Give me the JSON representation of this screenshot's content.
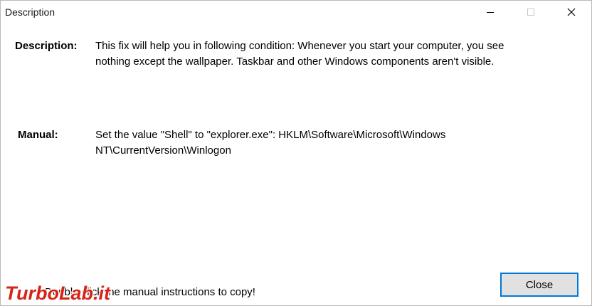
{
  "window": {
    "title": "Description"
  },
  "description": {
    "label": "Description:",
    "lines": [
      "This fix will help you in following condition: Whenever you start your computer, you see",
      "nothing except the wallpaper. Taskbar and other Windows components aren't visible."
    ]
  },
  "manual": {
    "label": "Manual:",
    "lines": [
      "Set the value \"Shell\" to \"explorer.exe\": HKLM\\Software\\Microsoft\\Windows",
      "NT\\CurrentVersion\\Winlogon"
    ]
  },
  "footer": {
    "hint": "Double click the manual instructions to copy!",
    "close_label": "Close"
  },
  "watermark": {
    "text": "TurboLab.it"
  },
  "colors": {
    "accent": "#0078d7",
    "button_face": "#e1e1e1",
    "watermark_red": "#d62418"
  },
  "icons": {
    "minimize": "minimize-icon",
    "maximize": "maximize-icon",
    "close": "close-icon"
  }
}
